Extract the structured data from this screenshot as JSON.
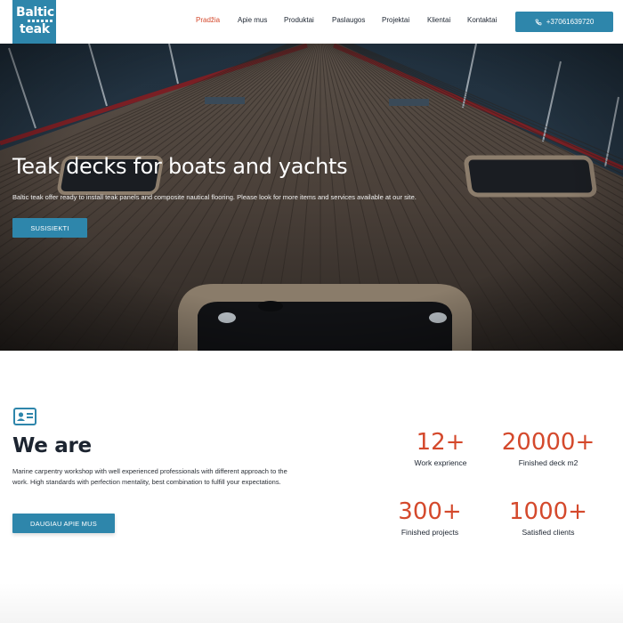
{
  "brand": {
    "logo_line1": "Baltic",
    "logo_line2": "teak",
    "color": "#2e86ab"
  },
  "nav": {
    "items": [
      {
        "label": "Pradžia",
        "active": true
      },
      {
        "label": "Apie mus"
      },
      {
        "label": "Produktai"
      },
      {
        "label": "Paslaugos"
      },
      {
        "label": "Projektai"
      },
      {
        "label": "Klientai"
      },
      {
        "label": "Kontaktai"
      }
    ],
    "phone_icon": "phone-icon",
    "phone": "+37061639720"
  },
  "hero": {
    "title": "Teak decks for boats and yachts",
    "subtitle": "Baltic teak offer ready to install teak panels and composite nautical flooring. Please look for more items and services available at our site.",
    "cta_label": "SUSISIEKTI"
  },
  "about": {
    "icon": "id-card-icon",
    "title": "We are",
    "text": "Marine carpentry workshop with well experienced professionals with different approach to the work. High standards with perfection mentality, best combination to fulfill your expectations.",
    "button_label": "DAUGIAU APIE MUS"
  },
  "stats": [
    {
      "value": "12+",
      "label": "Work exprience"
    },
    {
      "value": "20000+",
      "label": "Finished deck m2"
    },
    {
      "value": "300+",
      "label": "Finished projects"
    },
    {
      "value": "1000+",
      "label": "Satisfied clients"
    }
  ],
  "colors": {
    "accent": "#d4492c",
    "primary": "#2e86ab"
  }
}
